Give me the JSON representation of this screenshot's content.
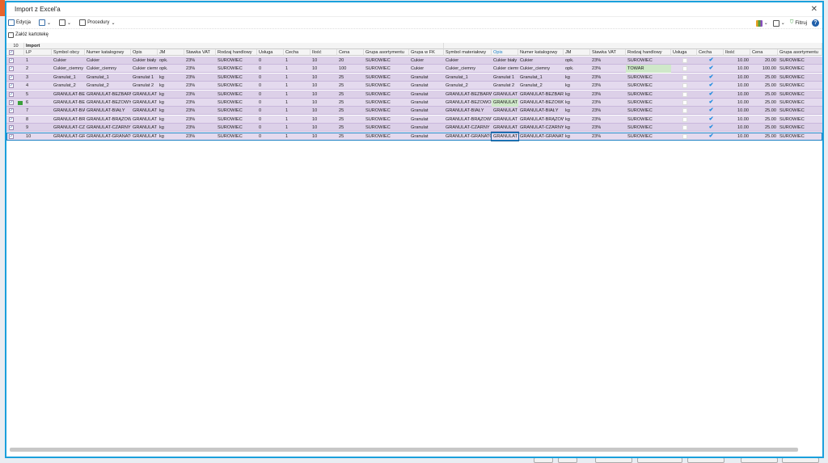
{
  "dialog": {
    "title": "Import z Excel'a",
    "close": "✕"
  },
  "toolbar": {
    "edit": "Edycja",
    "procedures": "Procedury",
    "filter": "Filtruj",
    "help": "?"
  },
  "toolbar2": {
    "create_card": "Załóż kartotekę"
  },
  "grid": {
    "count": "10",
    "group_label": "Import",
    "left_columns": [
      "LP",
      "Symbol obcy",
      "Numer katalogowy",
      "Opis",
      "JM",
      "Stawka VAT",
      "Rodzaj handlowy",
      "Usługa",
      "Cecha",
      "Ilość",
      "Cena",
      "Grupa asortymentu",
      "Grupa w FK"
    ],
    "right_columns": [
      "Symbol materiałowy",
      "Opis",
      "Numer katalogowy",
      "JM",
      "Stawka VAT",
      "Rodzaj handlowy",
      "Usługa",
      "Cecha",
      "Ilość",
      "Cena",
      "Grupa asortymentu"
    ],
    "rows": [
      {
        "checked": true,
        "left": [
          "1",
          "Cukier",
          "Cukier",
          "Cukier biały",
          "opk.",
          "23%",
          "SUROWIEC",
          "0",
          "1",
          "10",
          "20",
          "SUROWIEC",
          "Cukier"
        ],
        "right": [
          "Cukier",
          "Cukier biały",
          "Cukier",
          "opk.",
          "23%",
          "SUROWIEC",
          "",
          "✔",
          "10.00",
          "20.00",
          "SUROWIEC"
        ]
      },
      {
        "checked": true,
        "left": [
          "2",
          "Cukier_ciemny",
          "Cukier_ciemny",
          "Cukier ciemny",
          "opk.",
          "23%",
          "SUROWIEC",
          "0",
          "1",
          "10",
          "100",
          "SUROWIEC",
          "Cukier"
        ],
        "right": [
          "Cukier_ciemny",
          "Cukier ciemny",
          "Cukier_ciemny",
          "opk.",
          "23%",
          "TOWAR",
          "",
          "✔",
          "10.00",
          "100.00",
          "SUROWIEC"
        ],
        "highlight": "rodzaj"
      },
      {
        "checked": true,
        "left": [
          "3",
          "Granulat_1",
          "Granulat_1",
          "Granulat 1",
          "kg",
          "23%",
          "SUROWIEC",
          "0",
          "1",
          "10",
          "25",
          "SUROWIEC",
          "Granulat"
        ],
        "right": [
          "Granulat_1",
          "Granulat 1",
          "Granulat_1",
          "kg",
          "23%",
          "SUROWIEC",
          "",
          "✔",
          "10.00",
          "25.00",
          "SUROWIEC"
        ]
      },
      {
        "checked": true,
        "left": [
          "4",
          "Granulat_2",
          "Granulat_2",
          "Granulat 2",
          "kg",
          "23%",
          "SUROWIEC",
          "0",
          "1",
          "10",
          "25",
          "SUROWIEC",
          "Granulat"
        ],
        "right": [
          "Granulat_2",
          "Granulat 2",
          "Granulat_2",
          "kg",
          "23%",
          "SUROWIEC",
          "",
          "✔",
          "10.00",
          "25.00",
          "SUROWIEC"
        ]
      },
      {
        "checked": true,
        "left": [
          "5",
          "GRANULAT-BEZBARWNY",
          "GRANULAT-BEZBARWNY",
          "GRANULAT",
          "kg",
          "23%",
          "SUROWIEC",
          "0",
          "1",
          "10",
          "25",
          "SUROWIEC",
          "Granulat"
        ],
        "right": [
          "GRANULAT-BEZBARWNY",
          "GRANULAT",
          "GRANULAT-BEZBARWNY",
          "kg",
          "23%",
          "SUROWIEC",
          "",
          "✔",
          "10.00",
          "25.00",
          "SUROWIEC"
        ]
      },
      {
        "checked": true,
        "marker": true,
        "left": [
          "6",
          "GRANULAT-BEZOWY",
          "GRANULAT-BEZOWY",
          "GRANULAT",
          "kg",
          "23%",
          "SUROWIEC",
          "0",
          "1",
          "10",
          "25",
          "SUROWIEC",
          "Granulat"
        ],
        "right": [
          "GRANULAT-BEZOWO-",
          "GRANULAT",
          "GRANULAT-BEZOWO",
          "kg",
          "23%",
          "SUROWIEC",
          "",
          "✔",
          "10.00",
          "25.00",
          "SUROWIEC"
        ],
        "highlight": "opis"
      },
      {
        "checked": true,
        "left": [
          "7",
          "GRANULAT-BIAŁY",
          "GRANULAT-BIAŁY",
          "GRANULAT",
          "kg",
          "23%",
          "SUROWIEC",
          "0",
          "1",
          "10",
          "25",
          "SUROWIEC",
          "Granulat"
        ],
        "right": [
          "GRANULAT-BIAŁY",
          "GRANULAT",
          "GRANULAT-BIAŁY",
          "kg",
          "23%",
          "SUROWIEC",
          "",
          "✔",
          "10.00",
          "25.00",
          "SUROWIEC"
        ]
      },
      {
        "checked": true,
        "left": [
          "8",
          "GRANULAT-BRĄZOWY",
          "GRANULAT-BRĄZOWY",
          "GRANULAT",
          "kg",
          "23%",
          "SUROWIEC",
          "0",
          "1",
          "10",
          "25",
          "SUROWIEC",
          "Granulat"
        ],
        "right": [
          "GRANULAT-BRĄZOWY",
          "GRANULAT",
          "GRANULAT-BRĄZOWY",
          "kg",
          "23%",
          "SUROWIEC",
          "",
          "✔",
          "10.00",
          "25.00",
          "SUROWIEC"
        ]
      },
      {
        "checked": true,
        "left": [
          "9",
          "GRANULAT-CZARNY",
          "GRANULAT-CZARNY",
          "GRANULAT",
          "kg",
          "23%",
          "SUROWIEC",
          "0",
          "1",
          "10",
          "25",
          "SUROWIEC",
          "Granulat"
        ],
        "right": [
          "GRANULAT-CZARNY",
          "GRANULAT",
          "GRANULAT-CZARNY",
          "kg",
          "23%",
          "SUROWIEC",
          "",
          "✔",
          "10.00",
          "25.00",
          "SUROWIEC"
        ]
      },
      {
        "checked": true,
        "selected": true,
        "left": [
          "10",
          "GRANULAT-GRANATOWY",
          "GRANULAT-GRANATOWY",
          "GRANULAT",
          "kg",
          "23%",
          "SUROWIEC",
          "0",
          "1",
          "10",
          "25",
          "SUROWIEC",
          "Granulat"
        ],
        "right": [
          "GRANULAT-GRANATOWY",
          "GRANULAT",
          "GRANULAT-GRANATOWY",
          "kg",
          "23%",
          "SUROWIEC",
          "",
          "✔",
          "10.00",
          "25.00",
          "SUROWIEC"
        ]
      }
    ]
  },
  "colors": {
    "accent": "#1aa0dc",
    "row": "#dcd0e8",
    "highlight": "#cfe8c9"
  }
}
